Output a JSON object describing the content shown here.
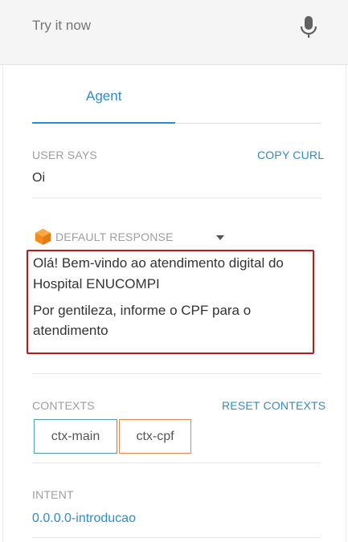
{
  "header": {
    "input_placeholder": "Try it now",
    "mic_icon": "microphone-icon"
  },
  "tabs": [
    {
      "label": "Agent",
      "active": true
    }
  ],
  "user_says": {
    "label": "USER SAYS",
    "action": "COPY CURL",
    "text": "Oi"
  },
  "default_response": {
    "icon": "dialogflow-hexagon-icon",
    "label": "DEFAULT RESPONSE",
    "lines": [
      "Olá! Bem-vindo ao atendimento digital do",
      "Hospital ENUCOMPI",
      "Por gentileza, informe o CPF para o",
      "atendimento"
    ]
  },
  "contexts": {
    "label": "CONTEXTS",
    "action": "RESET CONTEXTS",
    "items": [
      "ctx-main",
      "ctx-cpf"
    ]
  },
  "intent": {
    "label": "INTENT",
    "value": "0.0.0.0-introducao"
  },
  "colors": {
    "accent": "#2f8ccb",
    "highlight_border": "#b71c1c",
    "chip_main": "#4aa3a8",
    "chip_cpf": "#e08a4a",
    "icon_orange": "#f28c1e"
  }
}
